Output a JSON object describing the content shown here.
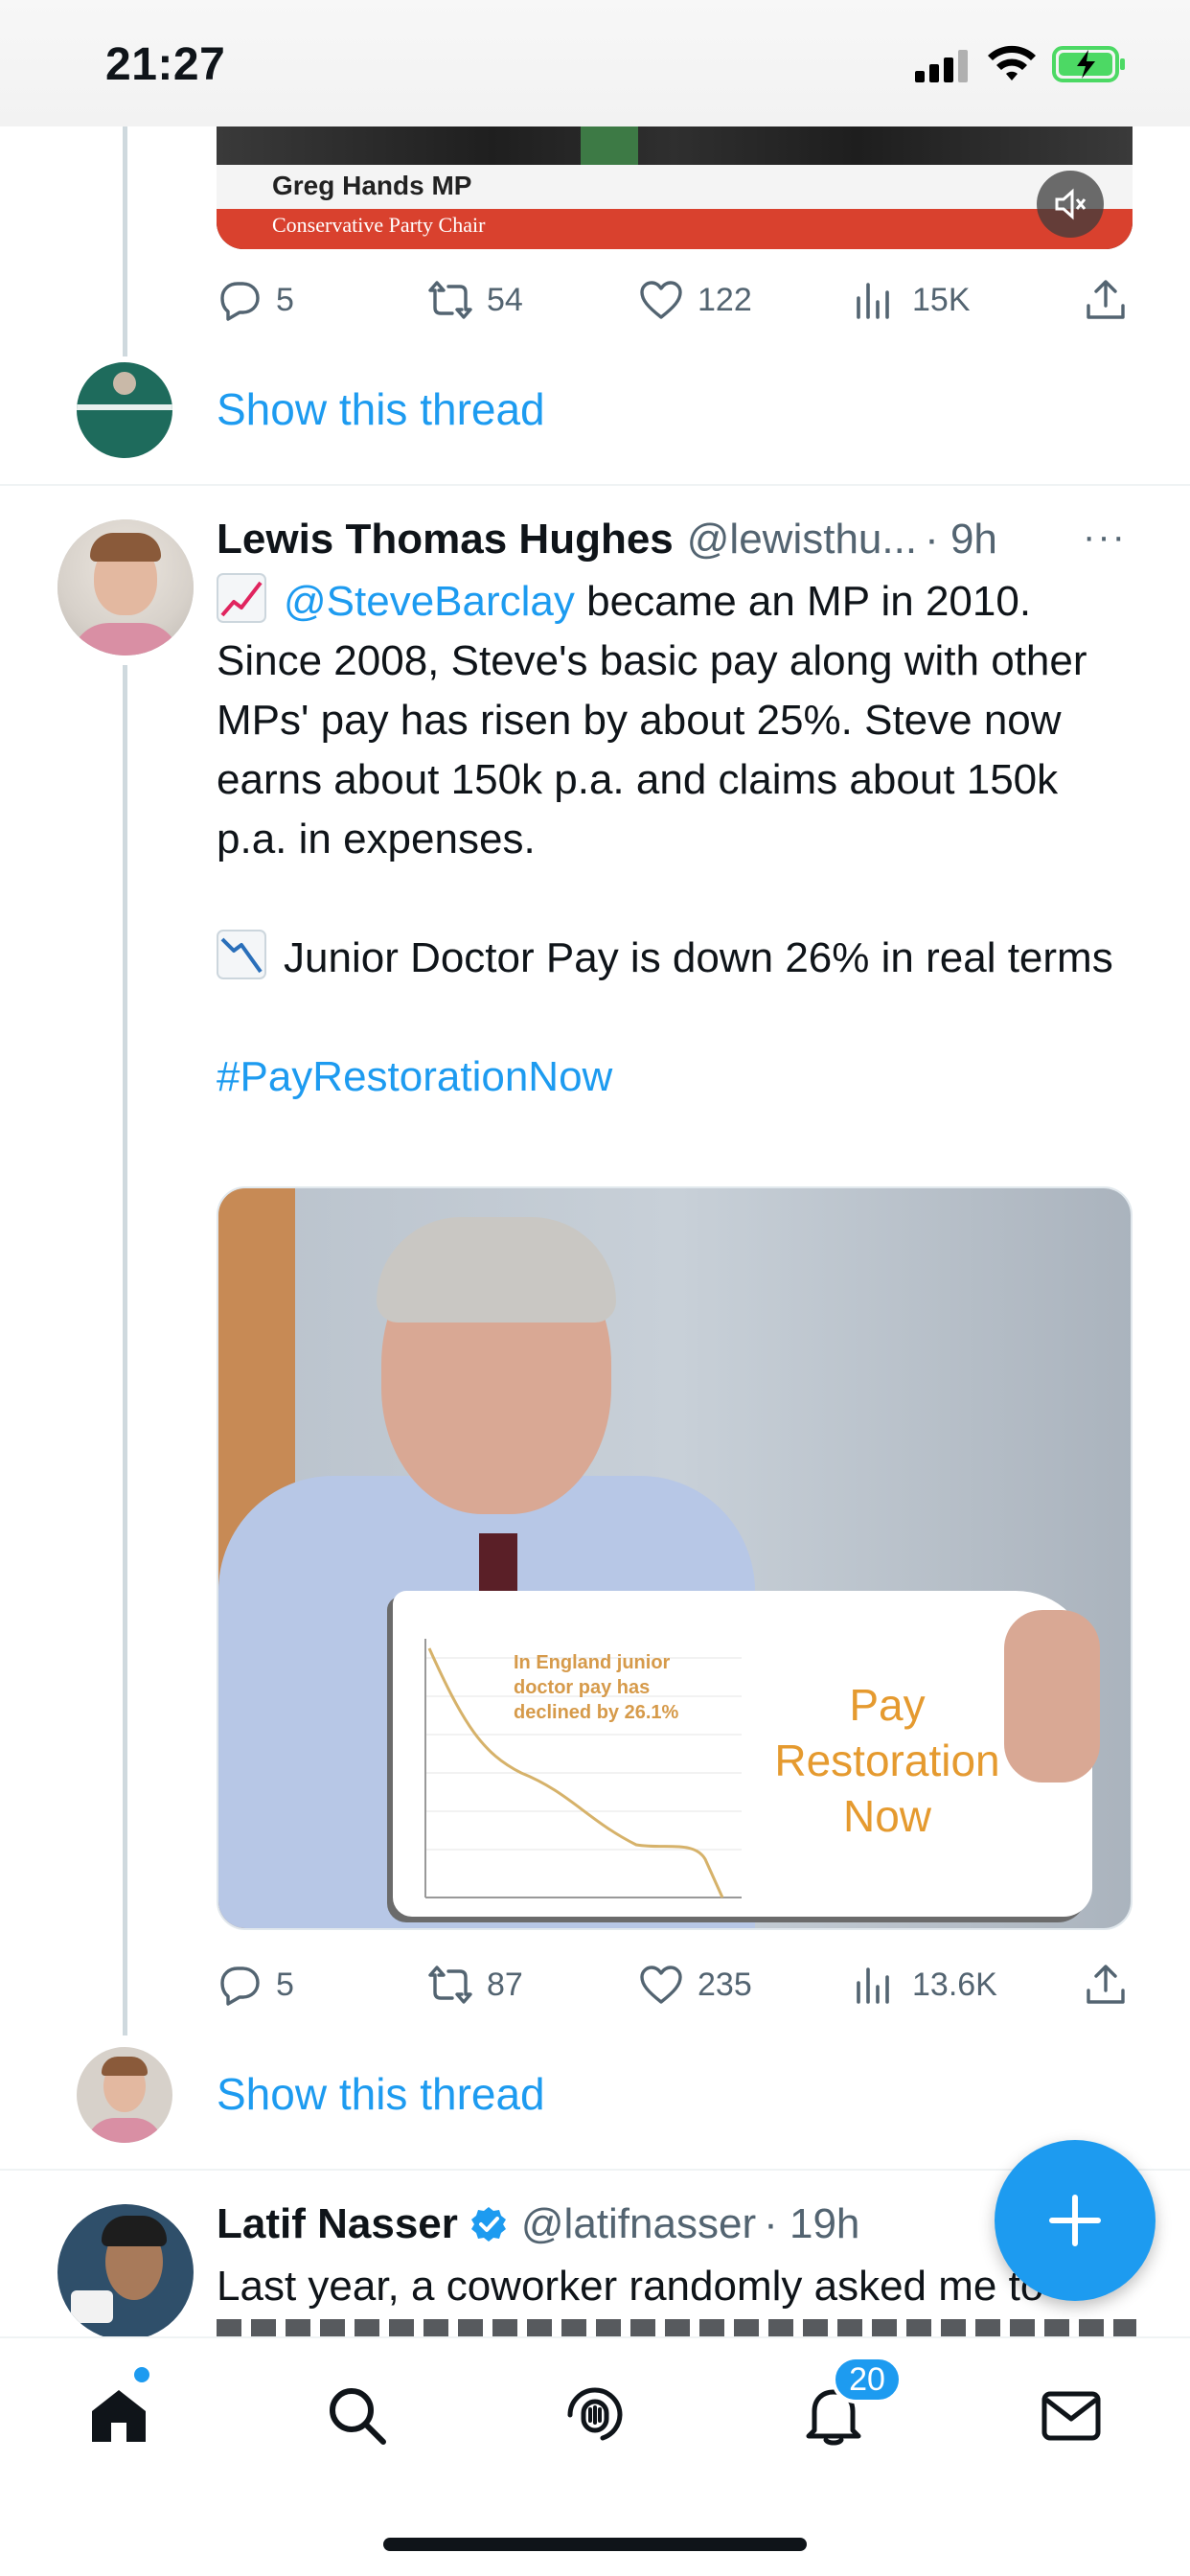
{
  "status_bar": {
    "time": "21:27"
  },
  "tweet_prev": {
    "video_caption_name": "Greg Hands MP",
    "video_caption_role": "Conservative Party Chair",
    "stats": {
      "replies": "5",
      "retweets": "54",
      "likes": "122",
      "views": "15K"
    },
    "show_thread": "Show this thread"
  },
  "tweet_main": {
    "name": "Lewis Thomas Hughes",
    "handle": "@lewisthu...",
    "time": "· 9h",
    "more": "···",
    "line1_mention": "@SteveBarclay",
    "line1_rest": " became an MP in 2010. Since 2008, Steve's basic pay along with other MPs' pay has risen by about 25%. Steve now earns about 150k p.a. and claims about 150k p.a. in expenses.",
    "line2": "Junior Doctor Pay is down 26% in real terms",
    "hashtag": "#PayRestorationNow",
    "image_chart_caption": "In England junior doctor pay has declined by 26.1%",
    "image_sign_text": "Pay Restoration Now",
    "stats": {
      "replies": "5",
      "retweets": "87",
      "likes": "235",
      "views": "13.6K"
    },
    "show_thread": "Show this thread"
  },
  "tweet_next": {
    "name": "Latif Nasser",
    "handle": "@latifnasser",
    "time": "· 19h",
    "text": "Last year, a coworker randomly asked me to"
  },
  "tabbar": {
    "notifications_badge": "20"
  },
  "colors": {
    "accent": "#1d9bf0",
    "text": "#0f1419",
    "muted": "#536471"
  },
  "icons": [
    "reply-icon",
    "retweet-icon",
    "like-icon",
    "views-icon",
    "share-icon",
    "home-icon",
    "search-icon",
    "spaces-icon",
    "bell-icon",
    "mail-icon",
    "compose-plus-icon",
    "verified-icon"
  ]
}
